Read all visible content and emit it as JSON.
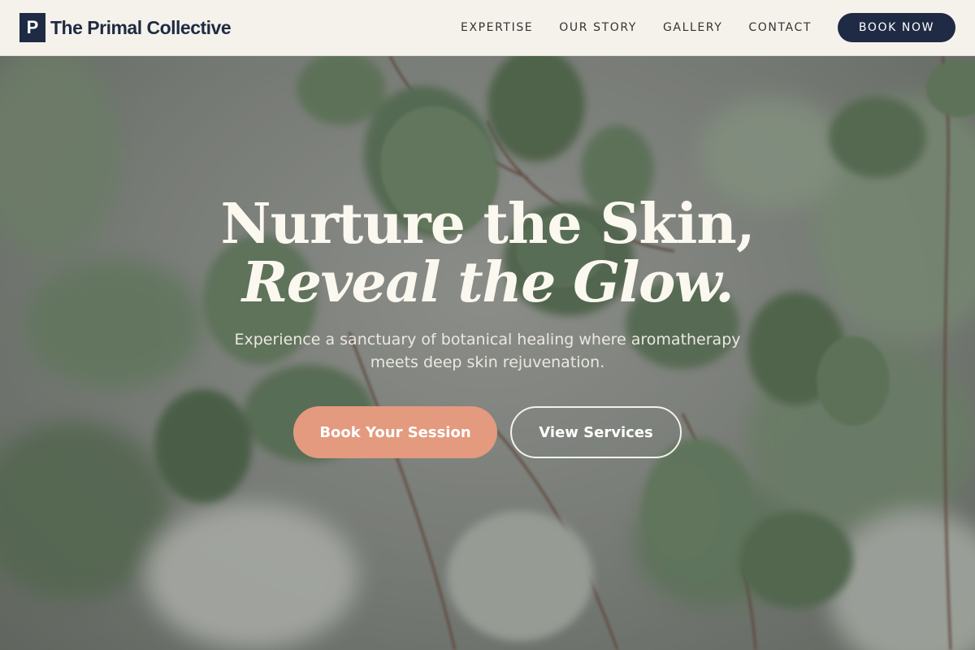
{
  "brand": {
    "logo_letter": "P",
    "name": "The Primal Collective"
  },
  "nav": {
    "items": [
      {
        "label": "EXPERTISE"
      },
      {
        "label": "OUR STORY"
      },
      {
        "label": "GALLERY"
      },
      {
        "label": "CONTACT"
      }
    ],
    "cta_label": "BOOK NOW"
  },
  "hero": {
    "headline_line1": "Nurture the Skin,",
    "headline_line2": "Reveal the Glow.",
    "subtitle": "Experience a sanctuary of botanical healing where aromatherapy meets deep skin rejuvenation.",
    "primary_button": "Book Your Session",
    "secondary_button": "View Services"
  },
  "colors": {
    "navy": "#1f2a44",
    "header_bg": "#f4f2ea",
    "accent_peach": "#e39a7e",
    "leaf_green": "#5f7a5c"
  }
}
